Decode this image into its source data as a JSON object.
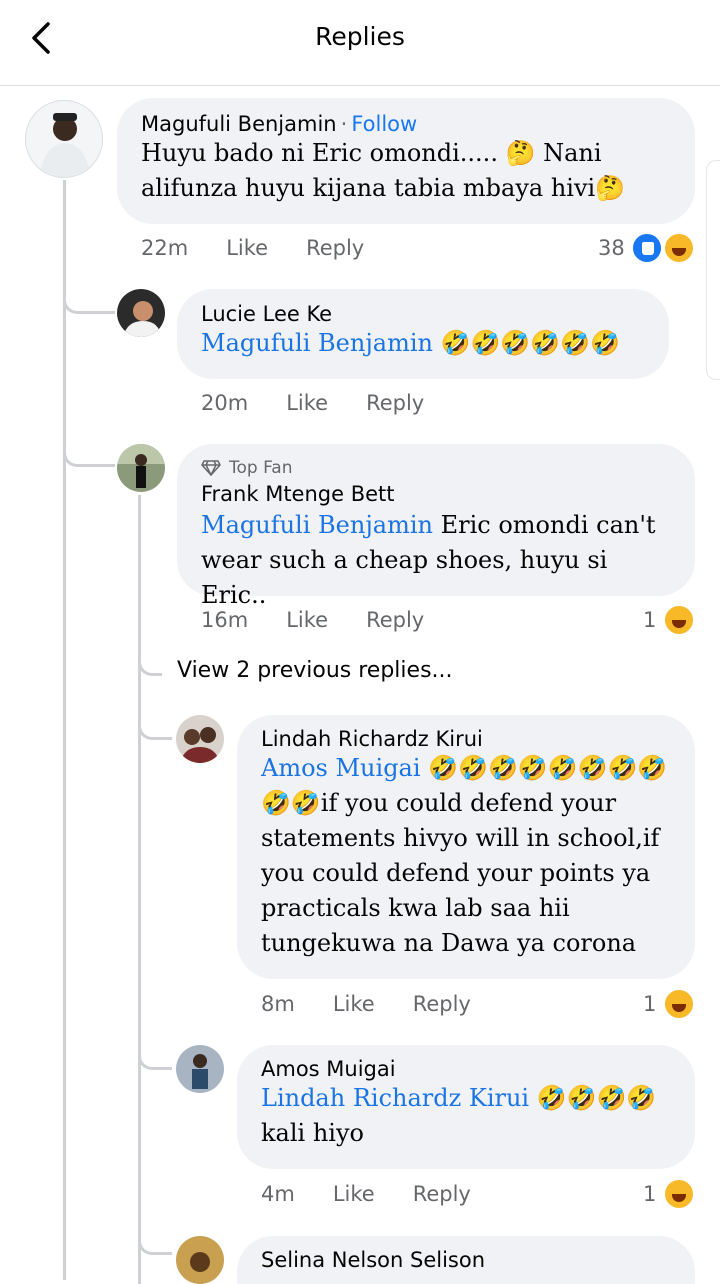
{
  "header": {
    "title": "Replies"
  },
  "comments": [
    {
      "author": "Magufuli Benjamin",
      "follow": "Follow",
      "text": "Huyu bado ni Eric omondi..... 🤔 Nani alifunza huyu kijana tabia mbaya hivi🤔",
      "time": "22m",
      "like": "Like",
      "reply": "Reply",
      "reaction_count": "38"
    },
    {
      "author": "Lucie Lee Ke",
      "mention": "Magufuli Benjamin",
      "text": "🤣🤣🤣🤣🤣🤣",
      "time": "20m",
      "like": "Like",
      "reply": "Reply"
    },
    {
      "badge": "Top Fan",
      "author": "Frank Mtenge Bett",
      "mention": "Magufuli Benjamin",
      "text": "Eric omondi can't wear such a cheap shoes, huyu si Eric..",
      "time": "16m",
      "like": "Like",
      "reply": "Reply",
      "reaction_count": "1"
    },
    {
      "author": "Lindah Richardz Kirui",
      "mention": "Amos Muigai",
      "text": "🤣🤣🤣🤣🤣🤣🤣🤣🤣🤣if you could defend your statements hivyo will in school,if you could defend your points ya practicals kwa lab saa hii tungekuwa na Dawa ya corona",
      "time": "8m",
      "like": "Like",
      "reply": "Reply",
      "reaction_count": "1"
    },
    {
      "author": "Amos Muigai",
      "mention": "Lindah Richardz Kirui",
      "text": "🤣🤣🤣🤣 kali hiyo",
      "time": "4m",
      "like": "Like",
      "reply": "Reply",
      "reaction_count": "1"
    },
    {
      "author": "Selina Nelson Selison"
    }
  ],
  "view_previous": "View 2 previous replies...",
  "colors": {
    "link": "#1877f2",
    "bubble": "#f0f2f5",
    "meta": "#65676b"
  }
}
